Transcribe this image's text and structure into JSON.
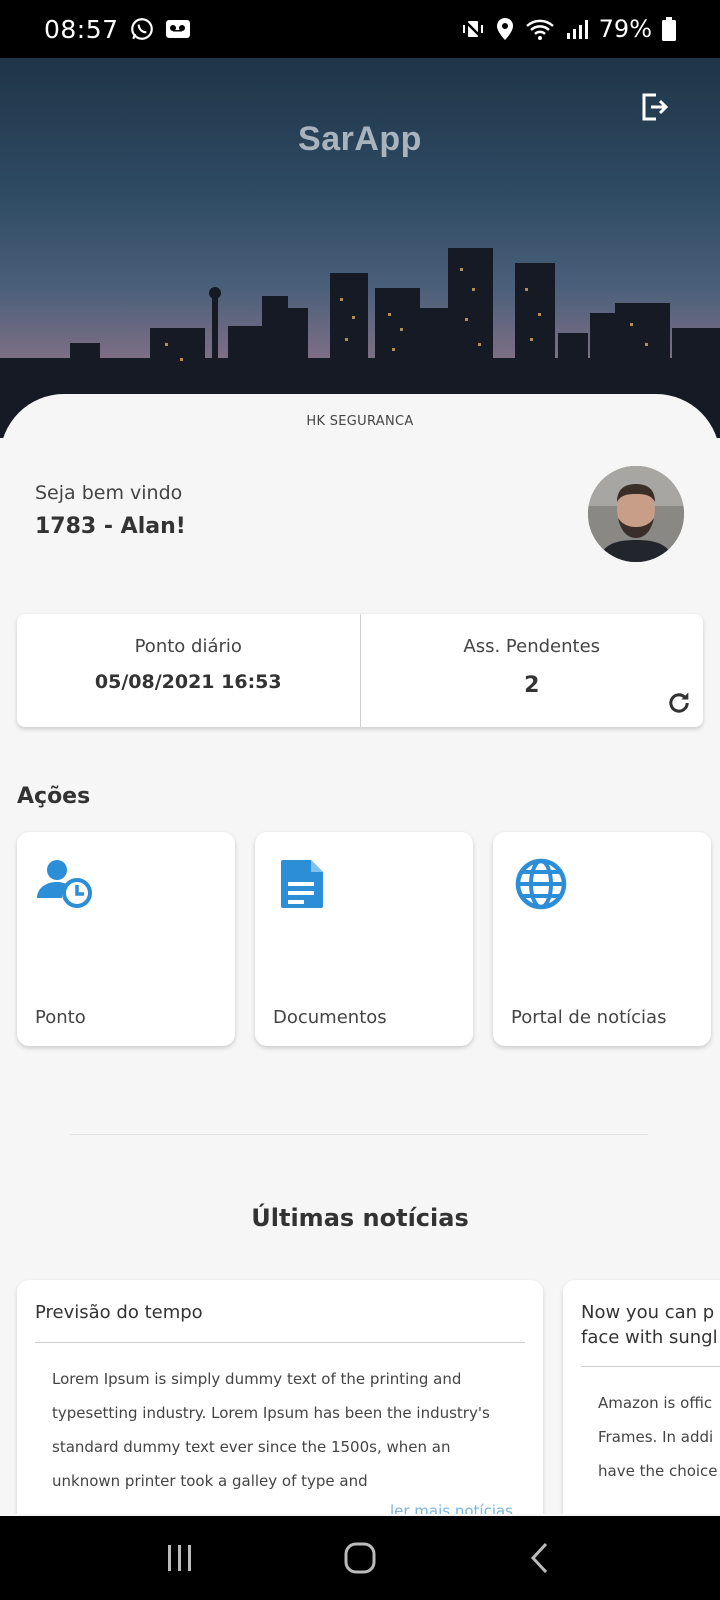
{
  "status_bar": {
    "time": "08:57",
    "battery": "79%"
  },
  "app": {
    "title": "SarApp"
  },
  "company": "HK SEGURANCA",
  "user": {
    "greeting": "Seja bem vindo",
    "name": "1783 - Alan!"
  },
  "summary": {
    "ponto_label": "Ponto diário",
    "ponto_value": "05/08/2021 16:53",
    "pendentes_label": "Ass. Pendentes",
    "pendentes_value": "2"
  },
  "actions": {
    "title": "Ações",
    "items": [
      {
        "label": "Ponto",
        "icon": "user-clock-icon"
      },
      {
        "label": "Documentos",
        "icon": "document-icon"
      },
      {
        "label": "Portal de notícias",
        "icon": "globe-icon"
      }
    ]
  },
  "news": {
    "title": "Últimas notícias",
    "items": [
      {
        "title": "Previsão do tempo",
        "body": "Lorem Ipsum is simply dummy text of the printing and typesetting industry. Lorem Ipsum has been the industry's standard dummy text ever since the 1500s, when an unknown printer took a galley of type and",
        "more": "ler mais notícias"
      },
      {
        "title": "Now you can p face with sungl",
        "body": "Amazon is offic Frames. In addi have the choice"
      }
    ]
  },
  "colors": {
    "accent": "#2b8ed6",
    "background": "#f6f6f6"
  }
}
